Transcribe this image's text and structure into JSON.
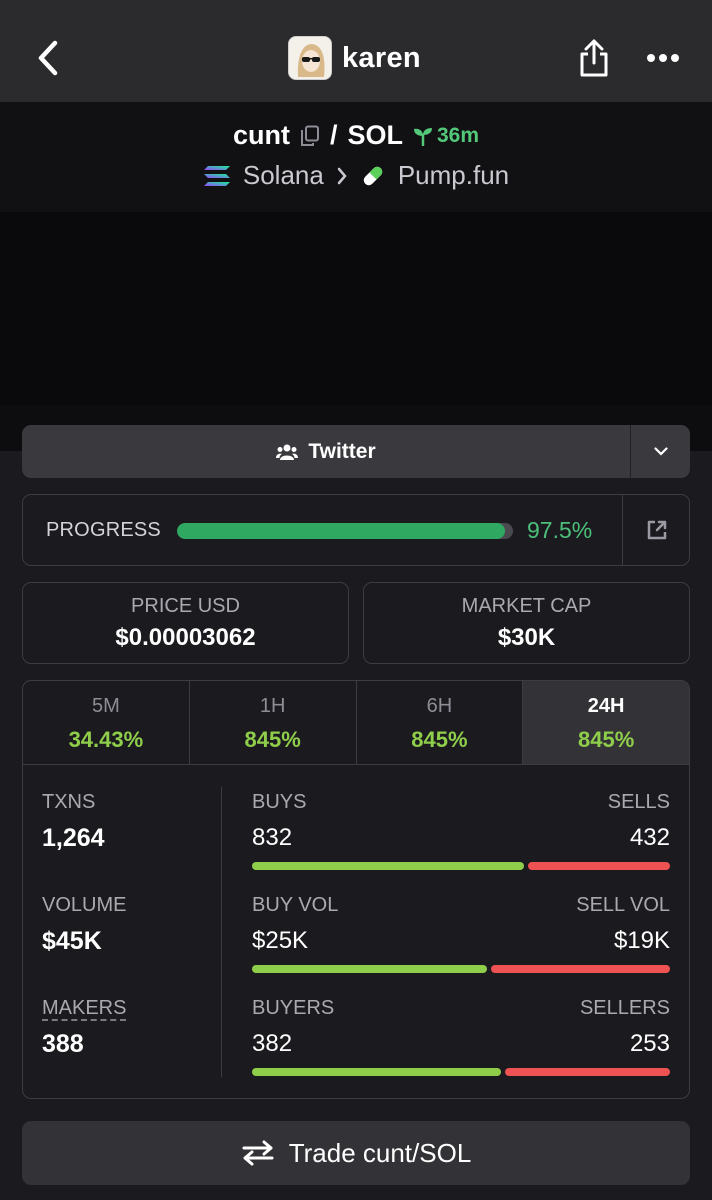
{
  "header": {
    "username": "karen",
    "icons": {
      "back": "chevron-left-icon",
      "share": "share-icon",
      "more": "more-horizontal-icon"
    }
  },
  "pair": {
    "base": "cunt",
    "separator": "/",
    "quote": "SOL",
    "age": "36m",
    "chain": "Solana",
    "dex": "Pump.fun"
  },
  "social": {
    "label": "Twitter"
  },
  "progress": {
    "label": "PROGRESS",
    "value_text": "97.5%",
    "percent": 97.5
  },
  "stats": {
    "price": {
      "label": "PRICE USD",
      "value": "$0.00003062"
    },
    "market_cap": {
      "label": "MARKET CAP",
      "value": "$30K"
    }
  },
  "timeframes": [
    {
      "label": "5M",
      "value": "34.43%",
      "active": false
    },
    {
      "label": "1H",
      "value": "845%",
      "active": false
    },
    {
      "label": "6H",
      "value": "845%",
      "active": false
    },
    {
      "label": "24H",
      "value": "845%",
      "active": true
    }
  ],
  "metrics": {
    "txns": {
      "label": "TXNS",
      "value": "1,264"
    },
    "volume": {
      "label": "VOLUME",
      "value": "$45K"
    },
    "makers": {
      "label": "MAKERS",
      "value": "388"
    }
  },
  "ratios": [
    {
      "left_label": "BUYS",
      "right_label": "SELLS",
      "left_value": "832",
      "right_value": "432",
      "buy_fraction": 0.658
    },
    {
      "left_label": "BUY VOL",
      "right_label": "SELL VOL",
      "left_value": "$25K",
      "right_value": "$19K",
      "buy_fraction": 0.568
    },
    {
      "left_label": "BUYERS",
      "right_label": "SELLERS",
      "left_value": "382",
      "right_value": "253",
      "buy_fraction": 0.602
    }
  ],
  "trade_button": {
    "label": "Trade cunt/SOL"
  },
  "colors": {
    "buy": "#8fce4a",
    "sell": "#ee5253",
    "progress": "#2fa862",
    "age": "#53c878"
  }
}
